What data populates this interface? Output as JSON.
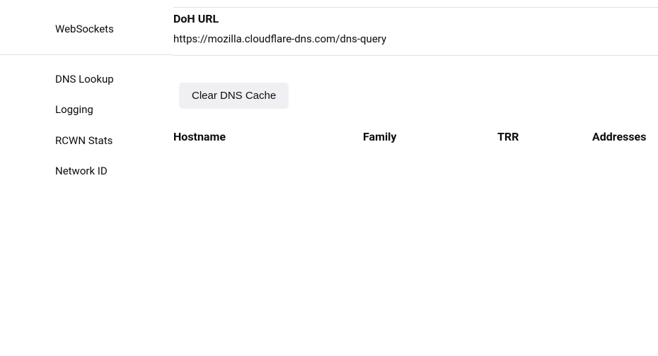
{
  "sidebar": {
    "items": [
      {
        "label": "WebSockets"
      },
      {
        "label": "DNS Lookup"
      },
      {
        "label": "Logging"
      },
      {
        "label": "RCWN Stats"
      },
      {
        "label": "Network ID"
      }
    ]
  },
  "doh": {
    "title": "DoH URL",
    "url": "https://mozilla.cloudflare-dns.com/dns-query"
  },
  "actions": {
    "clear_dns_cache": "Clear DNS Cache"
  },
  "table": {
    "headers": {
      "hostname": "Hostname",
      "family": "Family",
      "trr": "TRR",
      "addresses": "Addresses"
    }
  }
}
